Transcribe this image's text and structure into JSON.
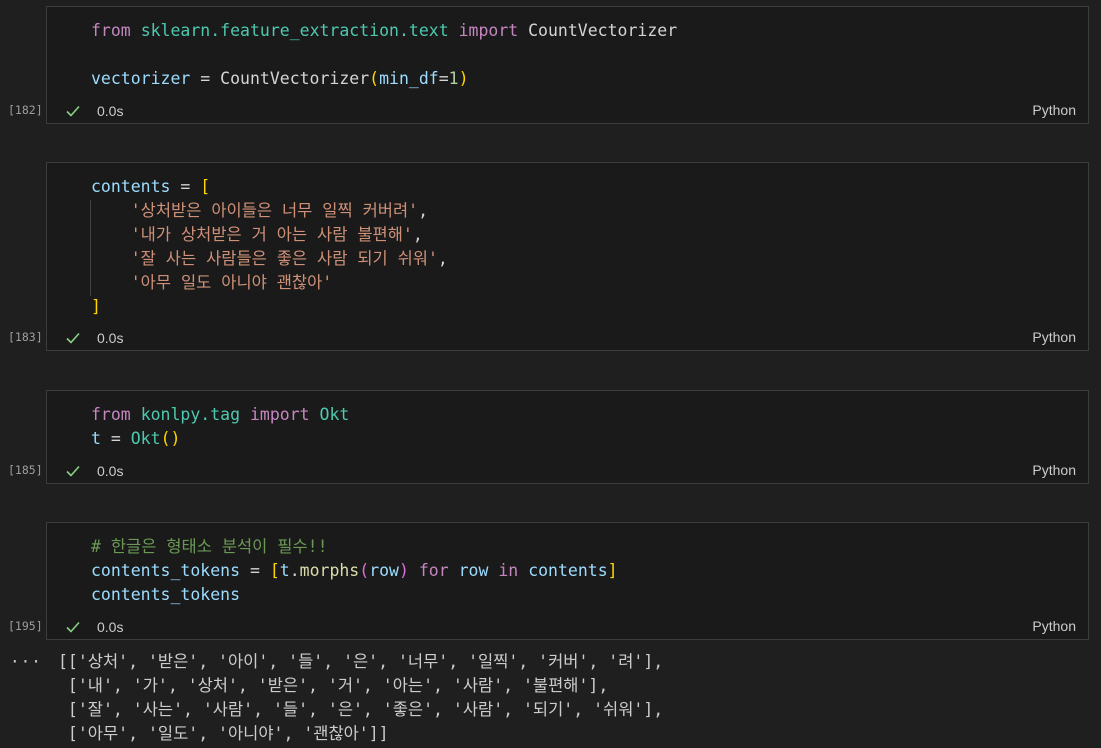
{
  "cells": [
    {
      "exec_count": "[182]",
      "time": "0.0s",
      "language": "Python",
      "code_lines": [
        "from sklearn.feature_extraction.text import CountVectorizer",
        "",
        "vectorizer = CountVectorizer(min_df=1)"
      ]
    },
    {
      "exec_count": "[183]",
      "time": "0.0s",
      "language": "Python",
      "code_lines": [
        "contents = [",
        "    '상처받은 아이들은 너무 일찍 커버려',",
        "    '내가 상처받은 거 아는 사람 불편해',",
        "    '잘 사는 사람들은 좋은 사람 되기 쉬워',",
        "    '아무 일도 아니야 괜찮아'",
        "]"
      ]
    },
    {
      "exec_count": "[185]",
      "time": "0.0s",
      "language": "Python",
      "code_lines": [
        "from konlpy.tag import Okt",
        "t = Okt()"
      ]
    },
    {
      "exec_count": "[195]",
      "time": "0.0s",
      "language": "Python",
      "code_lines": [
        "# 한글은 형태소 분석이 필수!!",
        "contents_tokens = [t.morphs(row) for row in contents]",
        "contents_tokens"
      ]
    }
  ],
  "output": {
    "more_icon": "ellipsis-icon",
    "lines": [
      "[['상처', '받은', '아이', '들', '은', '너무', '일찍', '커버', '려'],",
      " ['내', '가', '상처', '받은', '거', '아는', '사람', '불편해'],",
      " ['잘', '사는', '사람', '들', '은', '좋은', '사람', '되기', '쉬워'],",
      " ['아무', '일도', '아니야', '괜찮아']]"
    ]
  },
  "colors": {
    "background": "#1f1f1f",
    "cell_background": "#1a1a1a",
    "keyword": "#c586c0",
    "module": "#4ec9b0",
    "function": "#dcdcaa",
    "variable": "#9cdcfe",
    "string": "#ce9178",
    "comment": "#6a9955",
    "success_check": "#89d185"
  }
}
